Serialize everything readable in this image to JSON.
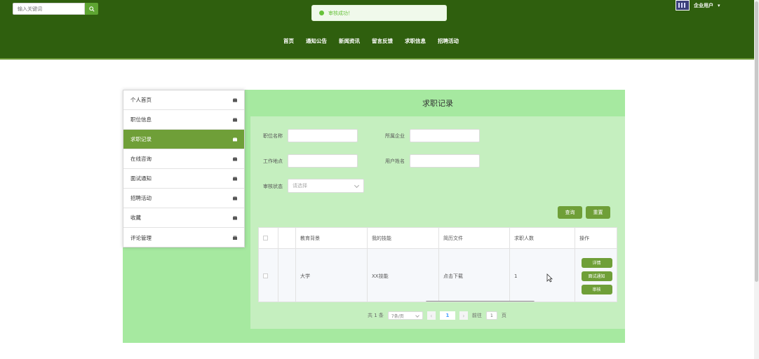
{
  "header": {
    "search_placeholder": "输入关键词",
    "toast": "审核成功！",
    "user_label": "企业用户",
    "nav": [
      "首页",
      "通知公告",
      "新闻资讯",
      "留言反馈",
      "求职信息",
      "招聘活动"
    ]
  },
  "sidebar": {
    "items": [
      {
        "label": "个人首页"
      },
      {
        "label": "职位信息"
      },
      {
        "label": "求职记录"
      },
      {
        "label": "在线咨询"
      },
      {
        "label": "面试通知"
      },
      {
        "label": "招聘活动"
      },
      {
        "label": "收藏"
      },
      {
        "label": "评论管理"
      }
    ],
    "active_index": 2
  },
  "panel": {
    "title": "求职记录",
    "form": {
      "job_name_label": "职位名称",
      "company_label": "所属企业",
      "location_label": "工作地点",
      "username_label": "用户姓名",
      "status_label": "审核状态",
      "status_placeholder": "请选择"
    },
    "buttons": {
      "query": "查询",
      "reset": "重置"
    },
    "table": {
      "headers": [
        "教育背景",
        "我的技能",
        "简历文件",
        "求职人数",
        "操作"
      ],
      "rows": [
        {
          "education": "大学",
          "skills": "XX技能",
          "resume": "点击下载",
          "count": "1"
        }
      ],
      "ops": [
        "详情",
        "面试通知",
        "审核"
      ]
    },
    "pager": {
      "total": "共 1 条",
      "page_size": "7条/页",
      "prev": "‹",
      "next": "›",
      "current": "1",
      "goto_prefix": "前往",
      "goto_value": "1",
      "goto_suffix": "页"
    }
  },
  "colors": {
    "header_bg": "#2f5f0e",
    "accent": "#6f9f38",
    "panel_bg": "#a6e9a0",
    "panel_inner": "#c5efbf"
  }
}
